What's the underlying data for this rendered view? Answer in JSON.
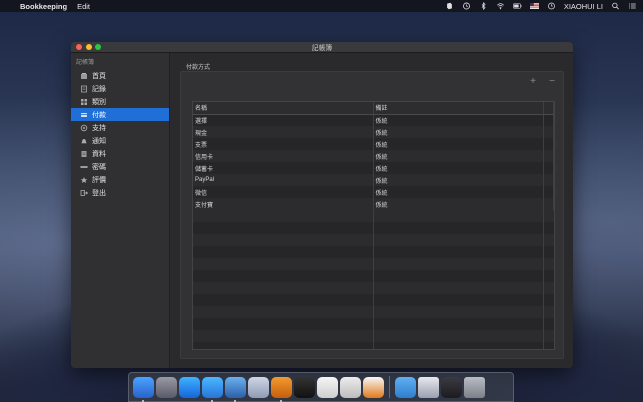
{
  "menubar": {
    "app_name": "Bookkeeping",
    "menus": [
      "Edit"
    ],
    "user": "XIAOHUI LI",
    "icons": [
      "apple-logo-icon",
      "evernote-icon",
      "time-machine-icon",
      "bluetooth-icon",
      "wifi-icon",
      "battery-icon",
      "us-flag-icon",
      "clock-icon",
      "search-icon",
      "list-icon"
    ]
  },
  "window": {
    "title": "記帳簿",
    "sidebar": {
      "heading": "記帳簿",
      "items": [
        {
          "label": "首頁",
          "icon": "home-icon"
        },
        {
          "label": "記錄",
          "icon": "record-icon"
        },
        {
          "label": "類別",
          "icon": "category-icon"
        },
        {
          "label": "付款",
          "icon": "payment-icon",
          "active": true
        },
        {
          "label": "支持",
          "icon": "support-icon"
        },
        {
          "label": "通知",
          "icon": "notification-icon"
        },
        {
          "label": "資料",
          "icon": "data-icon"
        },
        {
          "label": "密碼",
          "icon": "password-icon"
        },
        {
          "label": "評價",
          "icon": "rating-icon"
        },
        {
          "label": "登出",
          "icon": "logout-icon"
        }
      ]
    },
    "content": {
      "section_label": "付款方式",
      "add_label": "+",
      "remove_label": "−",
      "table": {
        "columns": [
          "名稱",
          "備註"
        ],
        "rows": [
          [
            "選擇",
            "係統"
          ],
          [
            "現金",
            "係統"
          ],
          [
            "支票",
            "係統"
          ],
          [
            "信用卡",
            "係統"
          ],
          [
            "儲蓄卡",
            "係統"
          ],
          [
            "PayPal",
            "係統"
          ],
          [
            "微信",
            "係統"
          ],
          [
            "支付寶",
            "係統"
          ]
        ]
      }
    }
  },
  "dock": {
    "apps": [
      "finder-icon",
      "launchpad-icon",
      "app-store-icon",
      "safari-icon",
      "xcode-icon",
      "box-icon",
      "sublime-icon",
      "terminal-icon",
      "notes-icon",
      "textedit-icon",
      "vlc-icon"
    ],
    "tail": [
      "downloads-folder-icon",
      "screen-icon",
      "display-icon",
      "trash-icon"
    ]
  }
}
